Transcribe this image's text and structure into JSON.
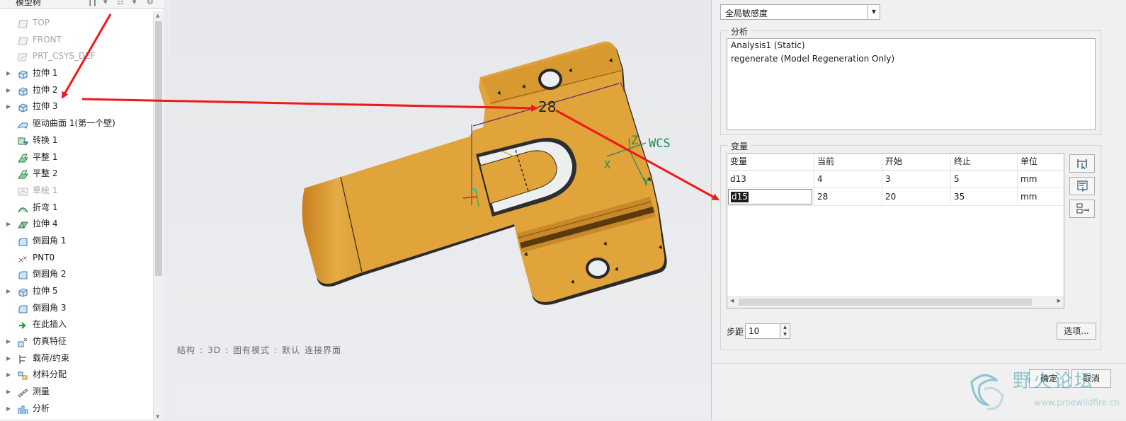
{
  "model_tree": {
    "title": "模型树",
    "items": [
      {
        "label": "TOP",
        "icon": "datum-plane-icon",
        "expandable": false,
        "dimmed": true
      },
      {
        "label": "FRONT",
        "icon": "datum-plane-icon",
        "expandable": false,
        "dimmed": true
      },
      {
        "label": "PRT_CSYS_DEF",
        "icon": "csys-icon",
        "expandable": false,
        "dimmed": true
      },
      {
        "label": "拉伸 1",
        "icon": "extrude-icon",
        "expandable": true,
        "dimmed": false
      },
      {
        "label": "拉伸 2",
        "icon": "extrude-icon",
        "expandable": true,
        "dimmed": false
      },
      {
        "label": "拉伸 3",
        "icon": "extrude-icon",
        "expandable": true,
        "dimmed": false
      },
      {
        "label": "驱动曲面 1(第一个壁)",
        "icon": "surface-icon",
        "expandable": false,
        "dimmed": false
      },
      {
        "label": "转换 1",
        "icon": "convert-icon",
        "expandable": false,
        "dimmed": false
      },
      {
        "label": "平整 1",
        "icon": "flat-wall-icon",
        "expandable": false,
        "dimmed": false
      },
      {
        "label": "平整 2",
        "icon": "flat-wall-icon",
        "expandable": false,
        "dimmed": false
      },
      {
        "label": "草绘 1",
        "icon": "sketch-icon",
        "expandable": false,
        "dimmed": true
      },
      {
        "label": "折弯 1",
        "icon": "bend-icon",
        "expandable": false,
        "dimmed": false
      },
      {
        "label": "拉伸 4",
        "icon": "extrude-cut-icon",
        "expandable": true,
        "dimmed": false
      },
      {
        "label": "倒圆角 1",
        "icon": "round-icon",
        "expandable": false,
        "dimmed": false
      },
      {
        "label": "PNT0",
        "icon": "datum-point-icon",
        "expandable": false,
        "dimmed": false
      },
      {
        "label": "倒圆角 2",
        "icon": "round-icon",
        "expandable": false,
        "dimmed": false
      },
      {
        "label": "拉伸 5",
        "icon": "extrude-icon",
        "expandable": true,
        "dimmed": false
      },
      {
        "label": "倒圆角 3",
        "icon": "round-icon",
        "expandable": false,
        "dimmed": false
      },
      {
        "label": "在此插入",
        "icon": "insert-here-arrow-icon",
        "expandable": false,
        "dimmed": false
      },
      {
        "label": "仿真特征",
        "icon": "simulation-feature-icon",
        "expandable": true,
        "dimmed": false
      },
      {
        "label": "载荷/约束",
        "icon": "load-constraint-icon",
        "expandable": true,
        "dimmed": false
      },
      {
        "label": "材料分配",
        "icon": "material-icon",
        "expandable": true,
        "dimmed": false
      },
      {
        "label": "测量",
        "icon": "measure-icon",
        "expandable": true,
        "dimmed": false
      },
      {
        "label": "分析",
        "icon": "analysis-icon",
        "expandable": true,
        "dimmed": false
      }
    ]
  },
  "viewport": {
    "dimension_label": "28",
    "csys_label": "WCS",
    "axis_z": "Z",
    "axis_x": "X",
    "axis_y": "Y",
    "status": [
      "结构",
      ":",
      "3D",
      ":",
      "固有模式",
      ":",
      "默认",
      "连接界面"
    ],
    "part_color": "#e0a43a"
  },
  "dialog": {
    "sensitivity_type": "全局敏感度",
    "analysis_group_title": "分析",
    "analyses": [
      "Analysis1 (Static)",
      "regenerate (Model Regeneration Only)"
    ],
    "variables_group_title": "变量",
    "variables_columns": [
      "变量",
      "当前",
      "开始",
      "终止",
      "单位"
    ],
    "variables_rows": [
      [
        "d13",
        "4",
        "3",
        "5",
        "mm"
      ],
      [
        "d15",
        "28",
        "20",
        "35",
        "mm"
      ]
    ],
    "step_label": "步距",
    "step_value": "10",
    "options_button": "选项...",
    "ok_button": "确定",
    "cancel_button": "取消"
  },
  "watermark": {
    "title": "野火论坛",
    "url": "www.proewildfire.cn"
  },
  "colors": {
    "annotation_arrow": "#f01818",
    "accent": "#3aa3b5"
  }
}
